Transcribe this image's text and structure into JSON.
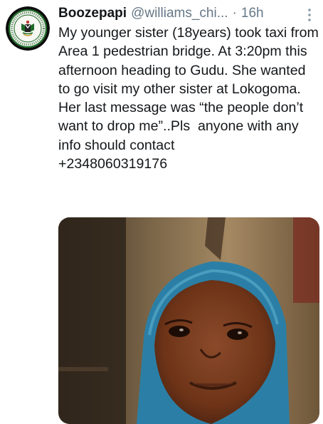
{
  "tweet": {
    "author": {
      "display_name": "Boozepapi",
      "handle": "@williams_chi...",
      "avatar_icon": "government-seal-logo"
    },
    "separator": "·",
    "time": "16h",
    "menu_icon": "more-vertical-icon",
    "text": "My younger sister (18years) took taxi from Area 1 pedestrian bridge. At 3:20pm this afternoon heading to Gudu. She wanted to go visit my other sister at Lokogoma. Her last message was “the people don’t want to drop me”..Pls  anyone with any info should contact\n+2348060319176",
    "media": {
      "type": "photo"
    }
  },
  "colors": {
    "text": "#14171a",
    "secondary_text": "#657786",
    "seal_green": "#1f6b2a",
    "headscarf_blue": "#2b7fa6"
  }
}
